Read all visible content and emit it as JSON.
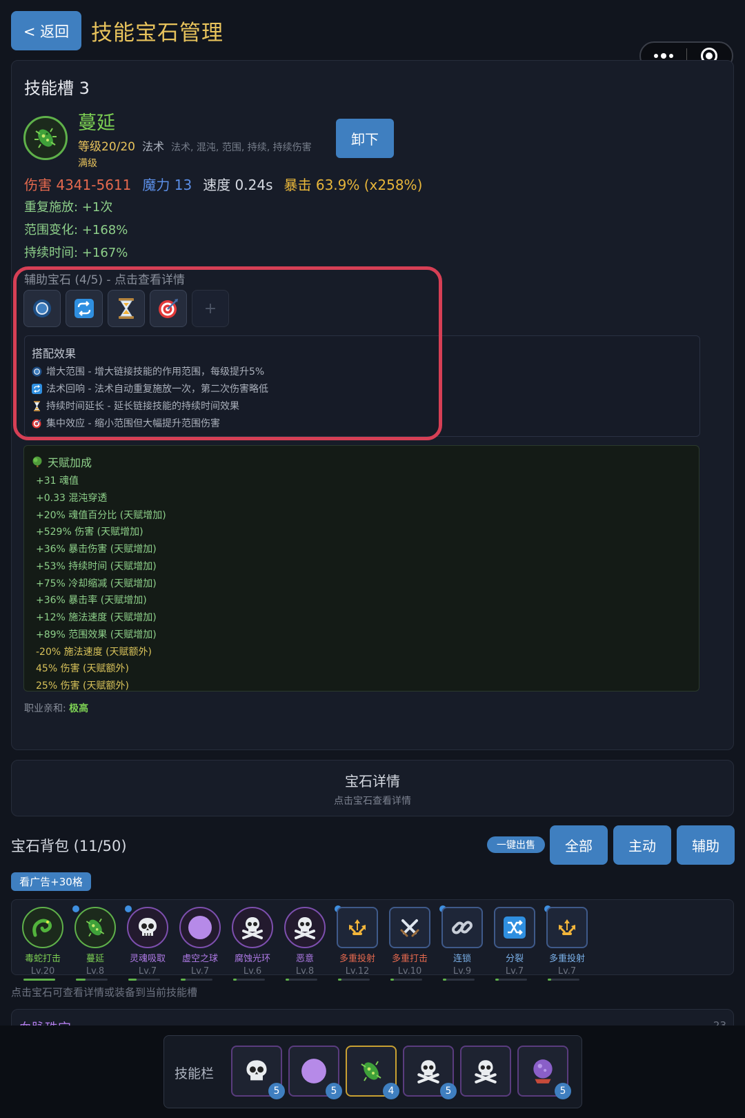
{
  "header": {
    "back_label": "< 返回",
    "title": "技能宝石管理"
  },
  "slot": {
    "title": "技能槽 3",
    "skill": {
      "name": "蔓延",
      "level": "等级20/20",
      "type": "法术",
      "tags": "法术, 混沌, 范围, 持续, 持续伤害",
      "max_label": "满级",
      "unequip_label": "卸下"
    },
    "stats": {
      "damage": "伤害 4341-5611",
      "mana": "魔力 13",
      "speed": "速度 0.24s",
      "crit": "暴击 63.9% (x258%)"
    },
    "bonuses": [
      "重复施放: +1次",
      "范围变化: +168%",
      "持续时间: +167%"
    ],
    "support_label": "辅助宝石 (4/5) - 点击查看详情",
    "support_gems": [
      {
        "icon": "blue-orb-icon"
      },
      {
        "icon": "repeat-arrows-icon"
      },
      {
        "icon": "hourglass-icon"
      },
      {
        "icon": "target-icon"
      }
    ],
    "empty_slot_label": "+",
    "combo": {
      "title": "搭配效果",
      "lines": [
        "增大范围 - 增大链接技能的作用范围，每级提升5%",
        "法术回响 - 法术自动重复施放一次，第二次伤害略低",
        "持续时间延长 - 延长链接技能的持续时间效果",
        "集中效应 - 缩小范围但大幅提升范围伤害"
      ]
    },
    "talent": {
      "title": "天赋加成",
      "lines": [
        "+31 魂值",
        "+0.33 混沌穿透",
        "+20% 魂值百分比 (天赋增加)",
        "+529% 伤害 (天赋增加)",
        "+36% 暴击伤害 (天赋增加)",
        "+53% 持续时间 (天赋增加)",
        "+75% 冷却缩减 (天赋增加)",
        "+36% 暴击率 (天赋增加)",
        "+12% 施法速度 (天赋增加)",
        "+89% 范围效果 (天赋增加)",
        "-20% 施法速度 (天赋额外)",
        "45% 伤害 (天赋额外)",
        "25% 伤害 (天赋额外)"
      ]
    },
    "affinity_label": "职业亲和:",
    "affinity_value": "极高"
  },
  "detail": {
    "title": "宝石详情",
    "subtitle": "点击宝石查看详情"
  },
  "bag": {
    "title": "宝石背包 (11/50)",
    "sell_label": "一键出售",
    "filters": [
      "全部",
      "主动",
      "辅助"
    ],
    "ad_label": "看广告+30格",
    "items": [
      {
        "name": "毒蛇打击",
        "level": "Lv.20",
        "icon": "snake-icon",
        "color": "#7ccf53",
        "progress": 1.0
      },
      {
        "name": "蔓延",
        "level": "Lv.8",
        "icon": "virus-icon",
        "color": "#7ccf53",
        "progress": 0.3
      },
      {
        "name": "灵魂吸取",
        "level": "Lv.7",
        "icon": "skull-icon",
        "color": "#b07be8",
        "progress": 0.25
      },
      {
        "name": "虚空之球",
        "level": "Lv.7",
        "icon": "void-orb-icon",
        "color": "#b07be8",
        "progress": 0.15
      },
      {
        "name": "腐蚀光环",
        "level": "Lv.6",
        "icon": "skull-crossbones-icon",
        "color": "#b07be8",
        "progress": 0.1
      },
      {
        "name": "恶意",
        "level": "Lv.8",
        "icon": "skull-crossbones-icon",
        "color": "#b07be8",
        "progress": 0.1
      },
      {
        "name": "多重投射",
        "level": "Lv.12",
        "icon": "multi-arrow-icon",
        "color": "#e5694e",
        "progress": 0.1
      },
      {
        "name": "多重打击",
        "level": "Lv.10",
        "icon": "crossed-swords-icon",
        "color": "#e5694e",
        "progress": 0.1
      },
      {
        "name": "连锁",
        "level": "Lv.9",
        "icon": "chain-icon",
        "color": "#7ab0e8",
        "progress": 0.1
      },
      {
        "name": "分裂",
        "level": "Lv.7",
        "icon": "shuffle-icon",
        "color": "#7ab0e8",
        "progress": 0.1
      },
      {
        "name": "多重投射",
        "level": "Lv.7",
        "icon": "multi-arrow-icon",
        "color": "#7ab0e8",
        "progress": 0.1
      }
    ],
    "hint": "点击宝石可查看详情或装备到当前技能槽"
  },
  "bottom_section": {
    "title": "血脉珠宝",
    "count": "23"
  },
  "skillbar": {
    "label": "技能栏",
    "slots": [
      {
        "icon": "skull-icon",
        "badge": "5"
      },
      {
        "icon": "void-orb-icon",
        "badge": "5"
      },
      {
        "icon": "virus-icon",
        "badge": "4"
      },
      {
        "icon": "skull-crossbones-icon",
        "badge": "5"
      },
      {
        "icon": "skull-crossbones-icon",
        "badge": ""
      },
      {
        "icon": "crystal-ball-icon",
        "badge": "5"
      }
    ]
  },
  "colors": {
    "accent": "#3f7fc0",
    "title": "#e8c35c",
    "green": "#7ccf53",
    "highlight": "#d63f55"
  }
}
